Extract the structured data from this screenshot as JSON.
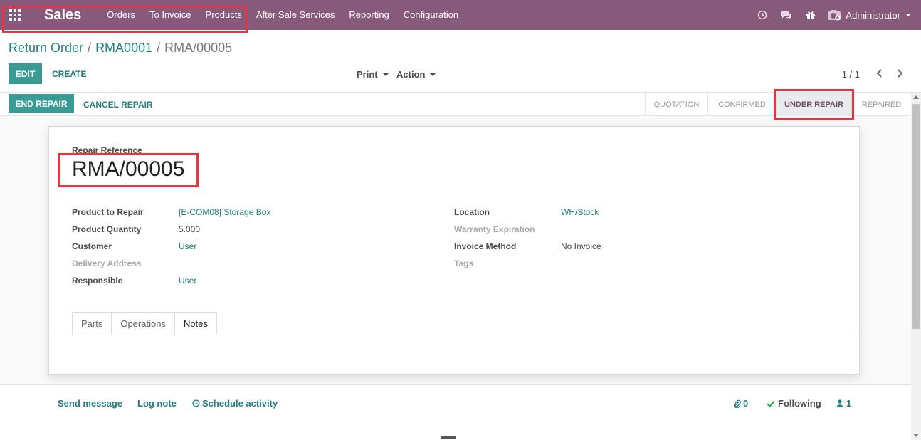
{
  "navbar": {
    "app_name": "Sales",
    "menu": [
      "Orders",
      "To Invoice",
      "Products",
      "After Sale Services",
      "Reporting",
      "Configuration"
    ],
    "user": "Administrator",
    "icons": [
      "activity-clock-icon",
      "discuss-chat-icon",
      "gift-icon",
      "user-avatar-icon"
    ]
  },
  "breadcrumb": {
    "items": [
      "Return Order",
      "RMA0001"
    ],
    "current": "RMA/00005",
    "separator": "/"
  },
  "buttons": {
    "edit": "EDIT",
    "create": "CREATE",
    "print": "Print",
    "action": "Action",
    "end_repair": "END REPAIR",
    "cancel_repair": "CANCEL REPAIR"
  },
  "pager": {
    "value": "1 / 1"
  },
  "status": {
    "steps": [
      "QUOTATION",
      "CONFIRMED",
      "UNDER REPAIR",
      "REPAIRED"
    ],
    "active": "UNDER REPAIR"
  },
  "form": {
    "reference_label": "Repair Reference",
    "reference": "RMA/00005",
    "left": [
      {
        "label": "Product to Repair",
        "value": "[E-COM08] Storage Box"
      },
      {
        "label": "Product Quantity",
        "value": "5.000"
      },
      {
        "label": "Customer",
        "value": "User"
      },
      {
        "label": "Delivery Address",
        "value": ""
      },
      {
        "label": "Responsible",
        "value": "User"
      }
    ],
    "right": [
      {
        "label": "Location",
        "value": "WH/Stock"
      },
      {
        "label": "Warranty Expiration",
        "value": ""
      },
      {
        "label": "Invoice Method",
        "value": "No Invoice"
      },
      {
        "label": "Tags",
        "value": ""
      }
    ],
    "tabs": [
      "Parts",
      "Operations",
      "Notes"
    ],
    "active_tab": "Notes"
  },
  "chatter": {
    "send_message": "Send message",
    "log_note": "Log note",
    "schedule_activity": "Schedule activity",
    "attachments": "0",
    "following": "Following",
    "followers": "1"
  },
  "colors": {
    "navbar": "#875a7b",
    "primary": "#3a9b95",
    "link": "#21807f",
    "highlight": "#e8343f"
  }
}
